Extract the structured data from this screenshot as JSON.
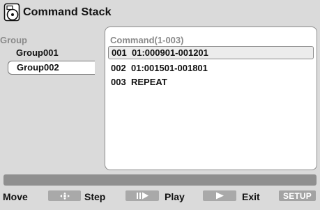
{
  "header": {
    "title": "Command Stack",
    "icon": "disc-menu-icon"
  },
  "groups": {
    "heading": "Group",
    "items": [
      {
        "label": "Group001",
        "selected": false
      },
      {
        "label": "Group002",
        "selected": true
      }
    ]
  },
  "commands": {
    "heading": "Command(1-003)",
    "rows": [
      {
        "num": "001",
        "text": "01:000901-001201",
        "highlighted": true
      },
      {
        "num": "002",
        "text": "01:001501-001801",
        "highlighted": false
      },
      {
        "num": "003",
        "text": "REPEAT",
        "highlighted": false
      }
    ]
  },
  "help": {
    "move_label": "Move",
    "move_icon": "four-way-arrows-icon",
    "step_label": "Step",
    "step_icon": "step-forward-icon",
    "play_label": "Play",
    "play_icon": "play-icon",
    "exit_label": "Exit",
    "exit_key": "SETUP"
  },
  "colors": {
    "background": "#dadada",
    "panel": "#ffffff",
    "heading_gray": "#8a8a8a",
    "key_gray": "#a9a9a9",
    "status_bar": "#8f8f8f"
  }
}
